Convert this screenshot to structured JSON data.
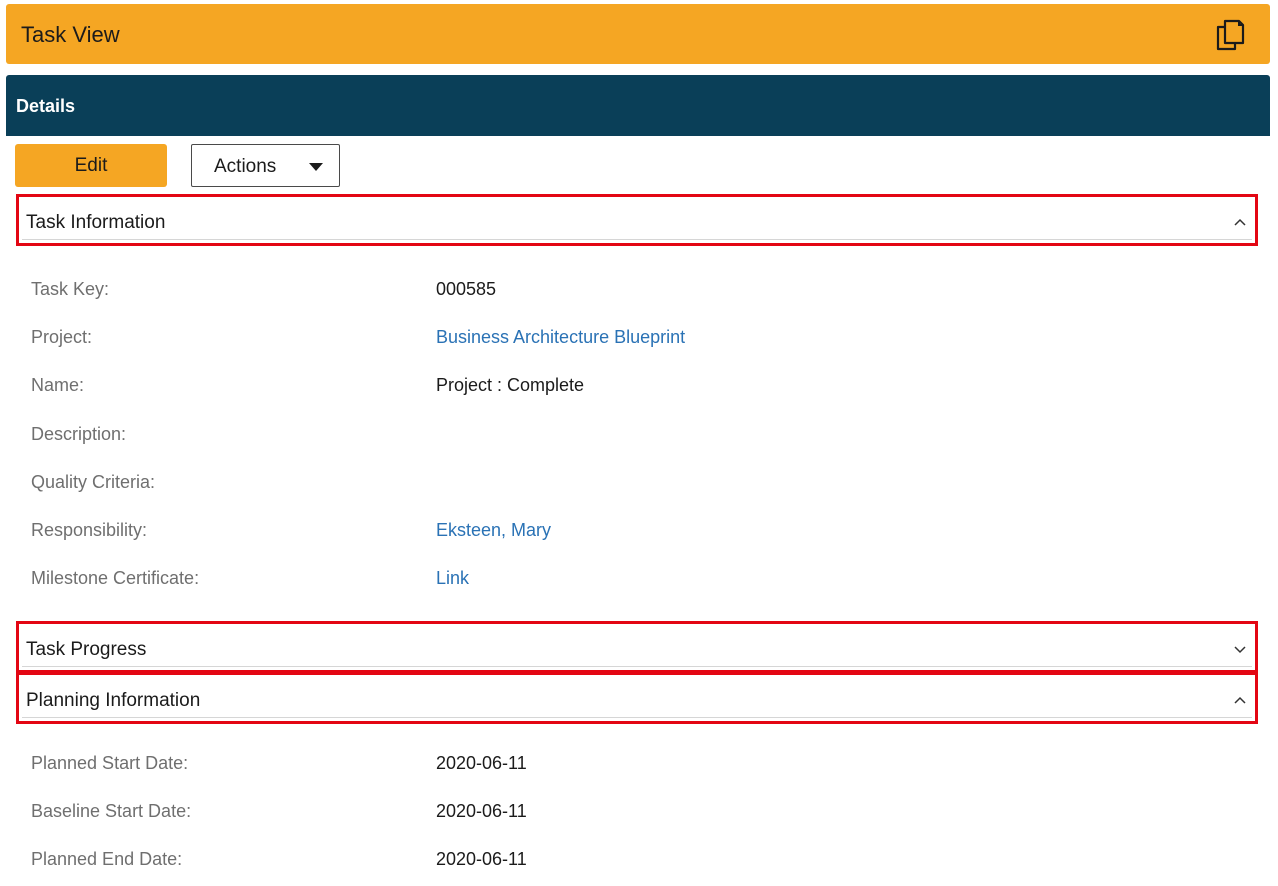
{
  "window": {
    "title": "Task View",
    "copy_icon": "copy-icon"
  },
  "details": {
    "label": "Details"
  },
  "toolbar": {
    "edit_label": "Edit",
    "actions_label": "Actions"
  },
  "sections": {
    "task_information": {
      "title": "Task Information",
      "expanded": true,
      "fields": [
        {
          "label": "Task Key:",
          "value": "000585"
        },
        {
          "label": "Project:",
          "value": "Business Architecture Blueprint",
          "link": true
        },
        {
          "label": "Name:",
          "value": "Project : Complete"
        },
        {
          "label": "Description:",
          "value": ""
        },
        {
          "label": "Quality Criteria:",
          "value": ""
        },
        {
          "label": "Responsibility:",
          "value": "Eksteen, Mary",
          "link": true
        },
        {
          "label": "Milestone Certificate:",
          "value": "Link",
          "link": true
        }
      ]
    },
    "task_progress": {
      "title": "Task Progress",
      "expanded": false
    },
    "planning_information": {
      "title": "Planning Information",
      "expanded": true,
      "fields": [
        {
          "label": "Planned Start Date:",
          "value": "2020-06-11"
        },
        {
          "label": "Baseline Start Date:",
          "value": "2020-06-11"
        },
        {
          "label": "Planned End Date:",
          "value": "2020-06-11"
        }
      ]
    }
  },
  "colors": {
    "accent_orange": "#f5a623",
    "header_navy": "#0a3f58",
    "highlight_red": "#e30613",
    "link_blue": "#2a72b5",
    "label_gray": "#6f6f6f"
  }
}
